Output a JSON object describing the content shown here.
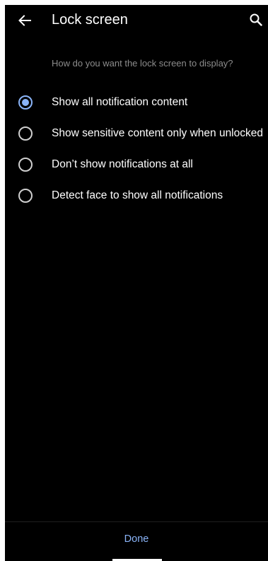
{
  "header": {
    "back_icon": "arrow-left-icon",
    "title": "Lock screen",
    "search_icon": "search-icon"
  },
  "prompt": "How do you want the lock screen to display?",
  "options": [
    {
      "label": "Show all notification content",
      "selected": true
    },
    {
      "label": "Show sensitive content only when unlocked",
      "selected": false
    },
    {
      "label": "Don’t show notifications at all",
      "selected": false
    },
    {
      "label": "Detect face to show all notifications",
      "selected": false
    }
  ],
  "footer": {
    "done_label": "Done"
  },
  "colors": {
    "background": "#000000",
    "accent": "#8ab4f8",
    "text_primary": "#ffffff",
    "text_secondary": "#8c8c8c"
  }
}
